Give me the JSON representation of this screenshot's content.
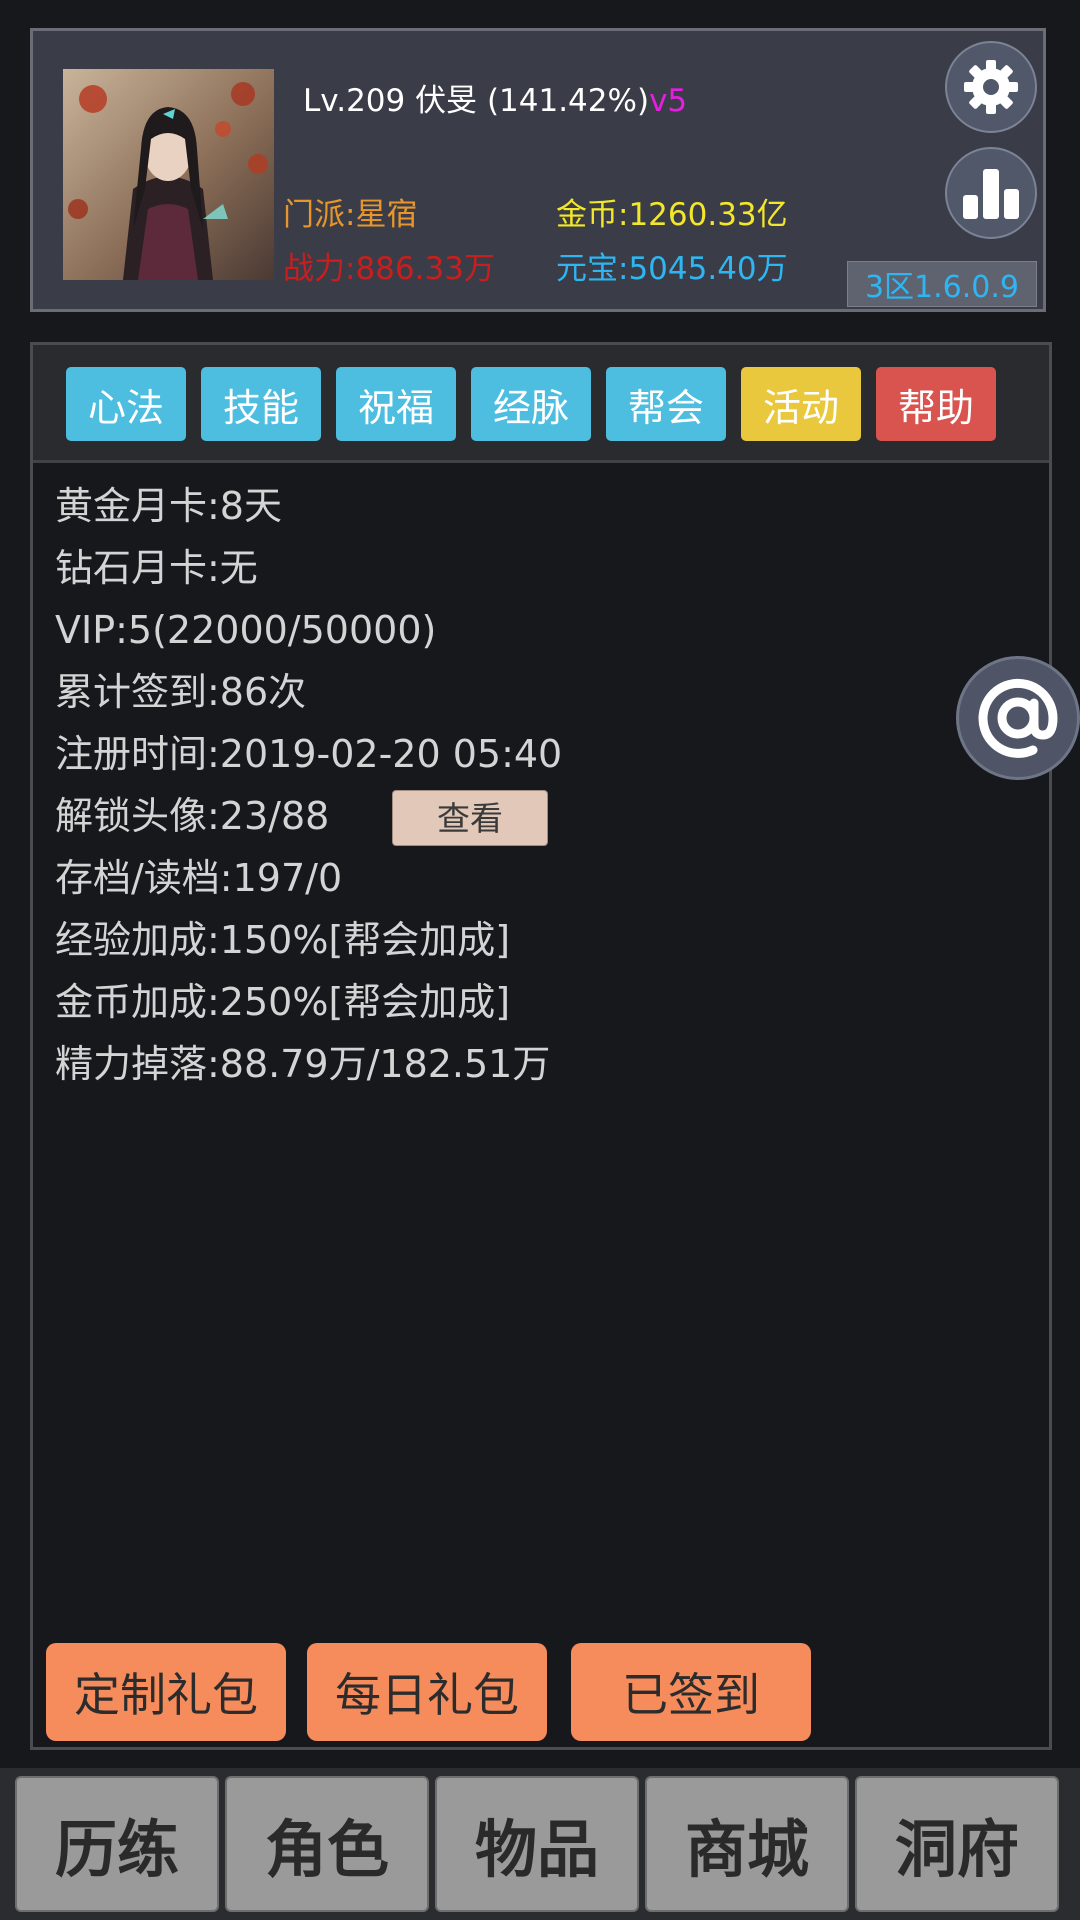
{
  "header": {
    "player_text": "Lv.209 伏旻 (141.42%)",
    "vip_tag": "v5",
    "sect": "门派:星宿",
    "power": "战力:886.33万",
    "gold": "金币:1260.33亿",
    "ingot": "元宝:5045.40万",
    "version": "3区1.6.0.9",
    "settings_icon": "gear-icon",
    "stats_icon": "bar-chart-icon"
  },
  "tabs": [
    {
      "label": "心法",
      "color": "#4dbde0"
    },
    {
      "label": "技能",
      "color": "#4dbde0"
    },
    {
      "label": "祝福",
      "color": "#4dbde0"
    },
    {
      "label": "经脉",
      "color": "#4dbde0"
    },
    {
      "label": "帮会",
      "color": "#4dbde0"
    },
    {
      "label": "活动",
      "color": "#e9c83d"
    },
    {
      "label": "帮助",
      "color": "#d9534f"
    }
  ],
  "info": [
    "黄金月卡:8天",
    "钻石月卡:无",
    "VIP:5(22000/50000)",
    "累计签到:86次",
    "注册时间:2019-02-20 05:40",
    "解锁头像:23/88",
    "存档/读档:197/0",
    "经验加成:150%[帮会加成]",
    "金币加成:250%[帮会加成]",
    "精力掉落:88.79万/182.51万"
  ],
  "view_button": "查看",
  "actions": [
    "定制礼包",
    "每日礼包",
    "已签到"
  ],
  "float_icon": "at-sign-icon",
  "nav": [
    "历练",
    "角色",
    "物品",
    "商城",
    "洞府"
  ],
  "colors": {
    "tab_blue": "#4dbde0",
    "tab_yellow": "#e9c83d",
    "tab_red": "#d9534f",
    "action_orange": "#f68b5b",
    "gold_text": "#f2e72a",
    "ingot_text": "#2fb6f2",
    "power_text": "#c81e1e",
    "sect_text": "#e8962c",
    "vip_text": "#e51fe0"
  }
}
